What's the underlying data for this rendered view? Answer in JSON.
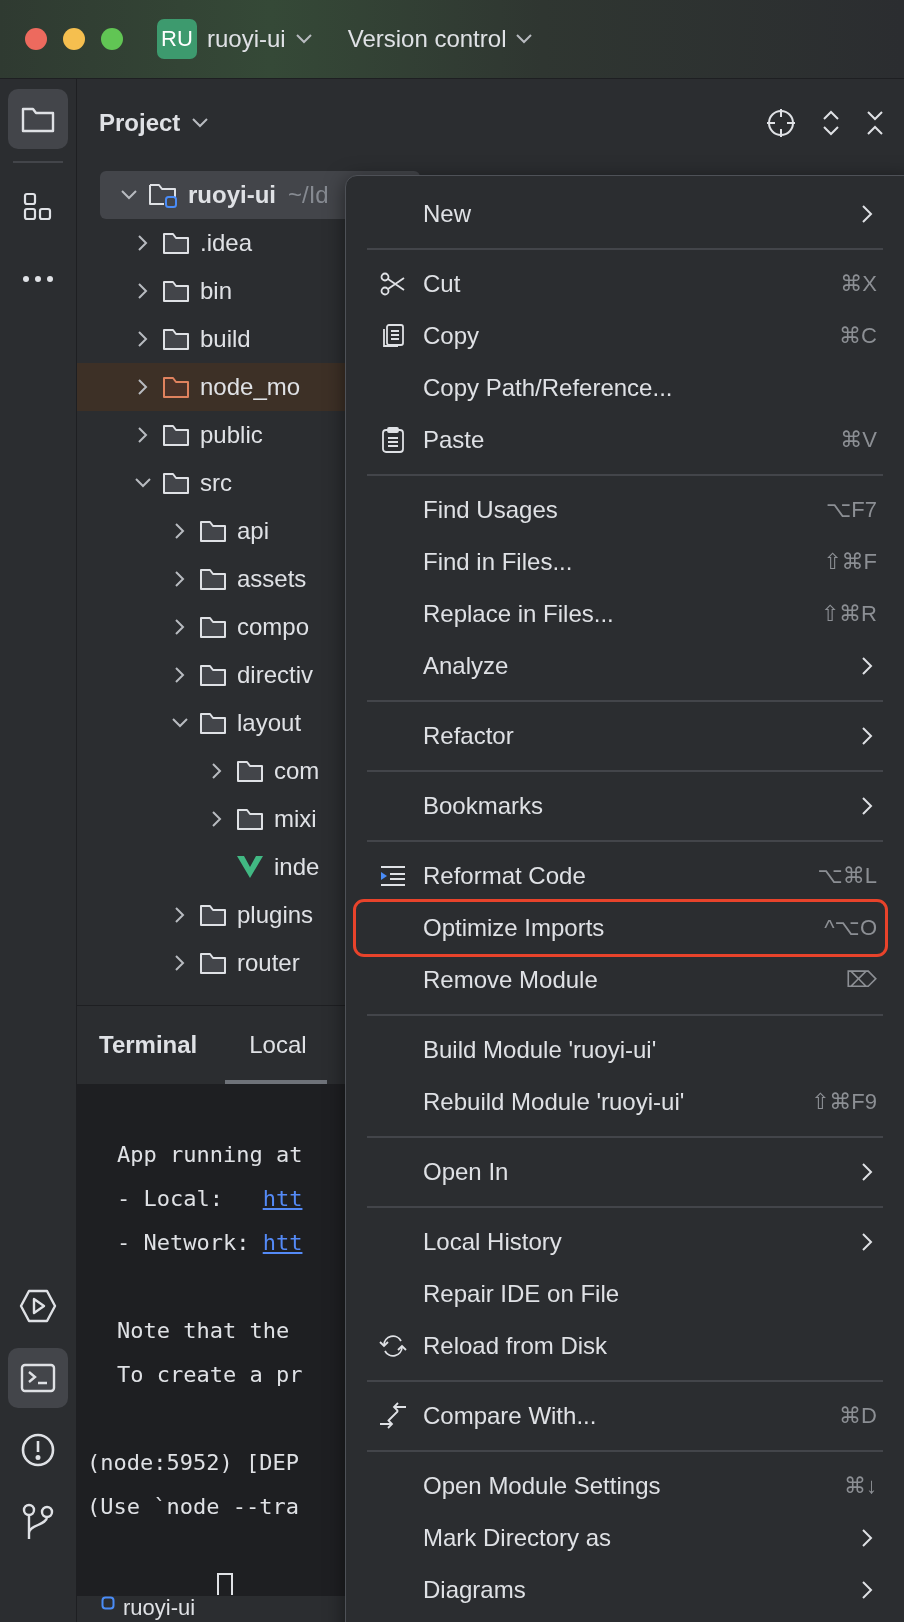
{
  "title_bar": {
    "project_badge": "RU",
    "project": "ruoyi-ui",
    "version_control": "Version control"
  },
  "tool_strip": {
    "top": [
      {
        "selected": true
      },
      {
        "selected": false
      },
      {
        "selected": false
      }
    ],
    "bottom": [
      {
        "selected": false
      },
      {
        "selected": true
      },
      {
        "selected": false
      },
      {
        "selected": false
      }
    ]
  },
  "project_panel": {
    "title": "Project",
    "tree": [
      {
        "kind": "module",
        "label": "ruoyi-ui",
        "path": "~/Id",
        "expanded": true,
        "selected": true,
        "excluded": false,
        "children": [
          {
            "kind": "folder",
            "label": ".idea",
            "expanded": false,
            "selected": false,
            "excluded": false
          },
          {
            "kind": "folder",
            "label": "bin",
            "expanded": false,
            "selected": false,
            "excluded": false
          },
          {
            "kind": "folder",
            "label": "build",
            "expanded": false,
            "selected": false,
            "excluded": false
          },
          {
            "kind": "folder",
            "label": "node_mo",
            "expanded": false,
            "selected": false,
            "excluded": true
          },
          {
            "kind": "folder",
            "label": "public",
            "expanded": false,
            "selected": false,
            "excluded": false
          },
          {
            "kind": "folder",
            "label": "src",
            "expanded": true,
            "selected": false,
            "excluded": false,
            "children": [
              {
                "kind": "folder",
                "label": "api",
                "expanded": false,
                "selected": false,
                "excluded": false
              },
              {
                "kind": "folder",
                "label": "assets",
                "expanded": false,
                "selected": false,
                "excluded": false
              },
              {
                "kind": "folder",
                "label": "compo",
                "expanded": false,
                "selected": false,
                "excluded": false
              },
              {
                "kind": "folder",
                "label": "directiv",
                "expanded": false,
                "selected": false,
                "excluded": false
              },
              {
                "kind": "folder",
                "label": "layout",
                "expanded": true,
                "selected": false,
                "excluded": false,
                "children": [
                  {
                    "kind": "folder",
                    "label": "com",
                    "expanded": false,
                    "selected": false,
                    "excluded": false
                  },
                  {
                    "kind": "folder",
                    "label": "mixi",
                    "expanded": false,
                    "selected": false,
                    "excluded": false
                  },
                  {
                    "kind": "vue",
                    "label": "inde",
                    "selected": false,
                    "excluded": false
                  }
                ]
              },
              {
                "kind": "folder",
                "label": "plugins",
                "expanded": false,
                "selected": false,
                "excluded": false
              },
              {
                "kind": "folder",
                "label": "router",
                "expanded": false,
                "selected": false,
                "excluded": false
              }
            ]
          }
        ]
      }
    ]
  },
  "terminal": {
    "title": "Terminal",
    "tabs": [
      {
        "label": "Local",
        "selected": true
      }
    ],
    "blocks": [
      {
        "indented": true,
        "lines": [
          {
            "text": "App running at"
          },
          {
            "text": "- Local:   ",
            "link": "htt"
          },
          {
            "text": "- Network: ",
            "link": "htt"
          }
        ]
      },
      {
        "indented": true,
        "lines": [
          {
            "text": "Note that the"
          },
          {
            "text": "To create a pr"
          }
        ]
      },
      {
        "indented": false,
        "lines": [
          {
            "text": "(node:5952) [DEP"
          },
          {
            "text": "(Use `node --tra"
          }
        ]
      }
    ]
  },
  "status_bar": {
    "module": "ruoyi-ui"
  },
  "context_menu": {
    "groups": [
      [
        {
          "label": "New",
          "submenu": true,
          "highlighted": false
        }
      ],
      [
        {
          "label": "Cut",
          "shortcut": "⌘X",
          "submenu": false,
          "highlighted": false
        },
        {
          "label": "Copy",
          "shortcut": "⌘C",
          "submenu": false,
          "highlighted": false
        },
        {
          "label": "Copy Path/Reference...",
          "submenu": false,
          "highlighted": false
        },
        {
          "label": "Paste",
          "shortcut": "⌘V",
          "submenu": false,
          "highlighted": false
        }
      ],
      [
        {
          "label": "Find Usages",
          "shortcut": "⌥F7",
          "submenu": false,
          "highlighted": false
        },
        {
          "label": "Find in Files...",
          "shortcut": "⇧⌘F",
          "submenu": false,
          "highlighted": false
        },
        {
          "label": "Replace in Files...",
          "shortcut": "⇧⌘R",
          "submenu": false,
          "highlighted": false
        },
        {
          "label": "Analyze",
          "submenu": true,
          "highlighted": false
        }
      ],
      [
        {
          "label": "Refactor",
          "submenu": true,
          "highlighted": false
        }
      ],
      [
        {
          "label": "Bookmarks",
          "submenu": true,
          "highlighted": false
        }
      ],
      [
        {
          "label": "Reformat Code",
          "shortcut": "⌥⌘L",
          "submenu": false,
          "highlighted": false
        },
        {
          "label": "Optimize Imports",
          "shortcut": "^⌥O",
          "submenu": false,
          "highlighted": true
        },
        {
          "label": "Remove Module",
          "shortcut": "⌦",
          "submenu": false,
          "highlighted": false
        }
      ],
      [
        {
          "label": "Build Module 'ruoyi-ui'",
          "submenu": false,
          "highlighted": false
        },
        {
          "label": "Rebuild Module 'ruoyi-ui'",
          "shortcut": "⇧⌘F9",
          "submenu": false,
          "highlighted": false
        }
      ],
      [
        {
          "label": "Open In",
          "submenu": true,
          "highlighted": false
        }
      ],
      [
        {
          "label": "Local History",
          "submenu": true,
          "highlighted": false
        },
        {
          "label": "Repair IDE on File",
          "submenu": false,
          "highlighted": false
        },
        {
          "label": "Reload from Disk",
          "submenu": false,
          "highlighted": false
        }
      ],
      [
        {
          "label": "Compare With...",
          "shortcut": "⌘D",
          "submenu": false,
          "highlighted": false
        }
      ],
      [
        {
          "label": "Open Module Settings",
          "shortcut": "⌘↓",
          "submenu": false,
          "highlighted": false
        },
        {
          "label": "Mark Directory as",
          "submenu": true,
          "highlighted": false
        },
        {
          "label": "Diagrams",
          "submenu": true,
          "highlighted": false
        }
      ]
    ]
  }
}
